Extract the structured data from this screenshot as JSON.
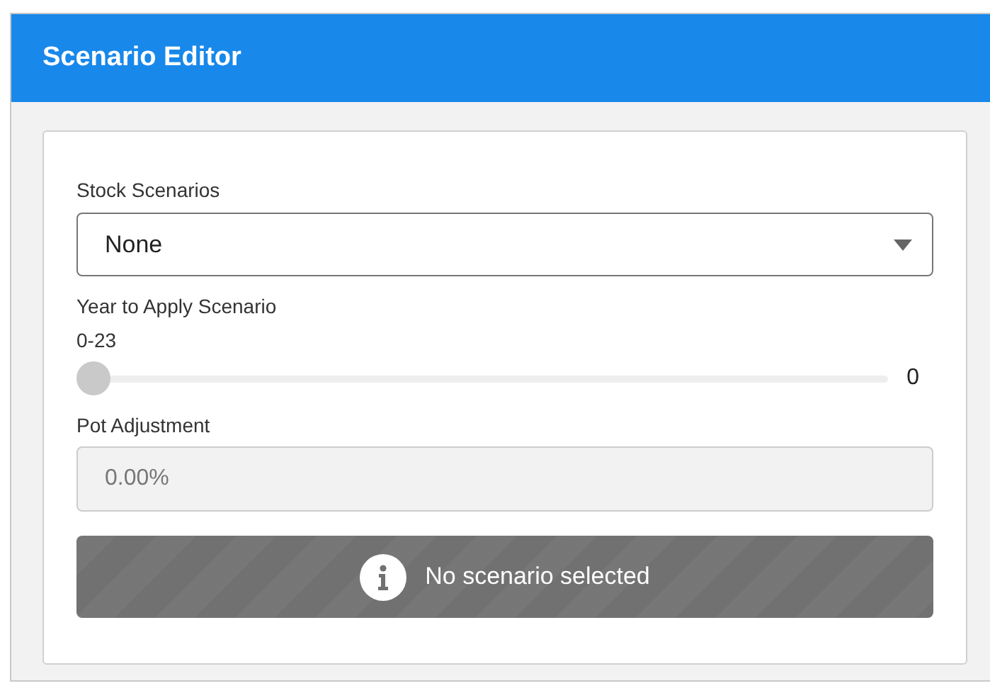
{
  "panel": {
    "title": "Scenario Editor"
  },
  "stock_scenarios": {
    "label": "Stock Scenarios",
    "value": "None"
  },
  "year": {
    "label": "Year to Apply Scenario",
    "range": "0-23",
    "level": 0,
    "reading": "0"
  },
  "pot_adjustment": {
    "label": "Pot Adjustment",
    "value": "0.00%",
    "disabled": true
  },
  "notice": {
    "text": "No scenario selected"
  }
}
